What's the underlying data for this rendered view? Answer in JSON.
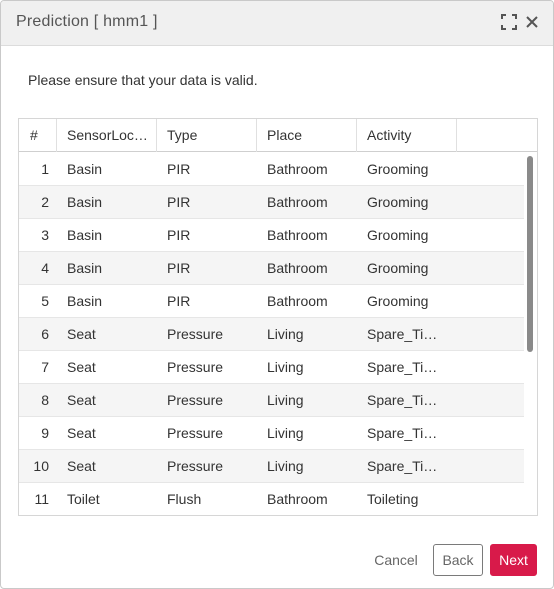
{
  "dialog": {
    "title": "Prediction [ hmm1 ]",
    "intro": "Please ensure that your data is valid.",
    "icons": {
      "maximize": "maximize-icon",
      "close": "close-icon"
    }
  },
  "table": {
    "columns": [
      "#",
      "SensorLoc…",
      "Type",
      "Place",
      "Activity"
    ],
    "rows": [
      {
        "n": "1",
        "sensor": "Basin",
        "type": "PIR",
        "place": "Bathroom",
        "activity": "Grooming"
      },
      {
        "n": "2",
        "sensor": "Basin",
        "type": "PIR",
        "place": "Bathroom",
        "activity": "Grooming"
      },
      {
        "n": "3",
        "sensor": "Basin",
        "type": "PIR",
        "place": "Bathroom",
        "activity": "Grooming"
      },
      {
        "n": "4",
        "sensor": "Basin",
        "type": "PIR",
        "place": "Bathroom",
        "activity": "Grooming"
      },
      {
        "n": "5",
        "sensor": "Basin",
        "type": "PIR",
        "place": "Bathroom",
        "activity": "Grooming"
      },
      {
        "n": "6",
        "sensor": "Seat",
        "type": "Pressure",
        "place": "Living",
        "activity": "Spare_Tim…"
      },
      {
        "n": "7",
        "sensor": "Seat",
        "type": "Pressure",
        "place": "Living",
        "activity": "Spare_Tim…"
      },
      {
        "n": "8",
        "sensor": "Seat",
        "type": "Pressure",
        "place": "Living",
        "activity": "Spare_Tim…"
      },
      {
        "n": "9",
        "sensor": "Seat",
        "type": "Pressure",
        "place": "Living",
        "activity": "Spare_Tim…"
      },
      {
        "n": "10",
        "sensor": "Seat",
        "type": "Pressure",
        "place": "Living",
        "activity": "Spare_Tim…"
      },
      {
        "n": "11",
        "sensor": "Toilet",
        "type": "Flush",
        "place": "Bathroom",
        "activity": "Toileting"
      }
    ]
  },
  "footer": {
    "cancel_label": "Cancel",
    "back_label": "Back",
    "next_label": "Next"
  },
  "colors": {
    "accent": "#d81a4a",
    "titlebar": "#f0f0f0",
    "row_alt": "#f5f5f5"
  }
}
